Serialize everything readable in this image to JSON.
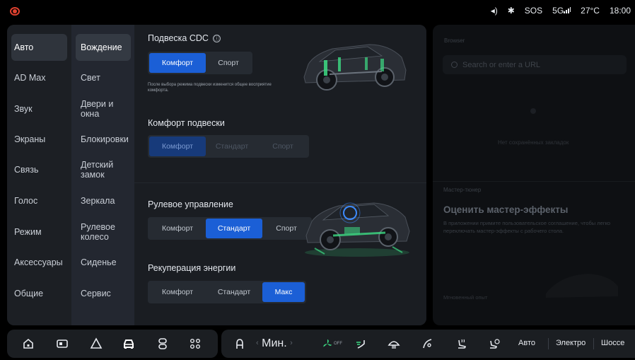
{
  "status_bar": {
    "items": [
      "◂)",
      "✱",
      "SOS",
      "5G",
      "27°C",
      "18:00"
    ]
  },
  "nav": {
    "categories": [
      "Авто",
      "AD Max",
      "Звук",
      "Экраны",
      "Связь",
      "Голос",
      "Режим",
      "Аксессуары",
      "Общие"
    ],
    "active_category": "Авто",
    "sub_items": [
      "Вождение",
      "Свет",
      "Двери и окна",
      "Блокировки",
      "Детский замок",
      "Зеркала",
      "Рулевое колесо",
      "Сиденье",
      "Сервис"
    ],
    "active_sub_item": "Вождение"
  },
  "content": {
    "cdc": {
      "title": "Подвеска CDC",
      "info_icon": "ⓘ",
      "options": [
        "Комфорт",
        "Спорт"
      ],
      "selected": "Комфорт",
      "note": "После выбора режима подвески изменится общее восприятие комфорта."
    },
    "comfort": {
      "title": "Комфорт подвески",
      "options": [
        "Комфорт",
        "Стандарт",
        "Спорт"
      ],
      "selected": "Комфорт"
    },
    "steering": {
      "title": "Рулевое управление",
      "options": [
        "Комфорт",
        "Стандарт",
        "Спорт"
      ],
      "selected": "Стандарт"
    },
    "regen": {
      "title": "Рекуперация энергии",
      "options": [
        "Комфорт",
        "Стандарт",
        "Макс"
      ],
      "selected": "Макс"
    }
  },
  "right_panel": {
    "browser_label": "Browser",
    "search_placeholder": "Search or enter a URL",
    "empty_text": "Нет сохранённых закладок",
    "tuner_label": "Мастер-тюнер",
    "tuner_title": "Оценить мастер-эффекты",
    "tuner_desc": "В приложении примите пользовательское соглашение, чтобы легко переключать мастер-эффекты с рабочего стола.",
    "instant_label": "Мгновенный опыт"
  },
  "dock": {
    "temp_label": "Мин.",
    "temp_left_arrow": "‹",
    "temp_right_arrow": "›",
    "fan_off_label": "OFF",
    "modes": [
      "Авто",
      "Электро",
      "Шоссе"
    ]
  },
  "colors": {
    "accent": "#1b5fd6",
    "logo": "#e0412f",
    "green_glow": "#3ddc84",
    "blue_glow": "#3d8bff"
  }
}
